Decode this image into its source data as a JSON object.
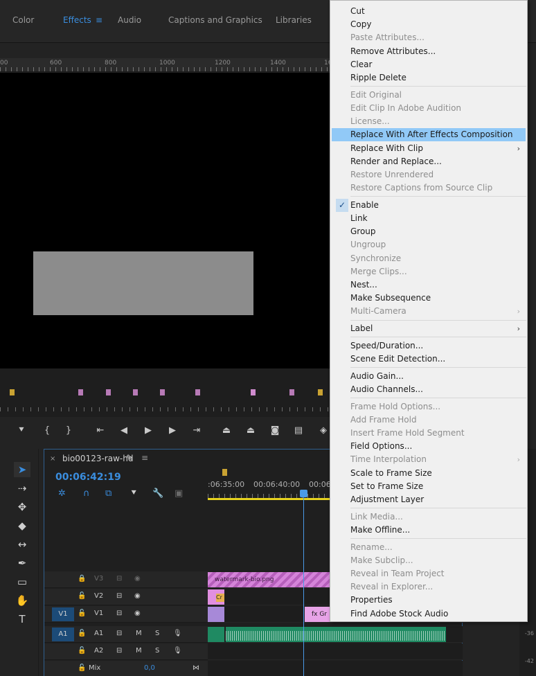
{
  "workspace_tabs": [
    {
      "label": "Color",
      "active": false
    },
    {
      "label": "Effects",
      "active": true
    },
    {
      "label": "Audio",
      "active": false
    },
    {
      "label": "Captions and Graphics",
      "active": false
    },
    {
      "label": "Libraries",
      "active": false
    }
  ],
  "program_ruler": [
    "00",
    "600",
    "800",
    "1000",
    "1200",
    "1400",
    "16"
  ],
  "sequence": {
    "close": "×",
    "name": "bio00123-raw-hd",
    "timecode": "00:06:42:19",
    "ruler_labels": [
      ":06:35:00",
      "00:06:40:00",
      "00:06"
    ]
  },
  "tracks": [
    {
      "target": "",
      "name": "V3",
      "dim": true
    },
    {
      "target": "",
      "name": "V2",
      "dim": false
    },
    {
      "target": "V1",
      "name": "V1",
      "dim": false
    },
    {
      "target": "A1",
      "name": "A1",
      "dim": false
    },
    {
      "target": "",
      "name": "A2",
      "dim": false
    }
  ],
  "track_buttons": {
    "mute": "M",
    "solo": "S"
  },
  "mix": {
    "label": "Mix",
    "value": "0,0"
  },
  "clips": {
    "watermark": "watermark-bio.png",
    "v2_label": "Cr",
    "v1_fx": "fx",
    "v1_label": "Gr"
  },
  "meter_labels": [
    "-36",
    "-42"
  ],
  "context_menu": [
    {
      "label": "Cut",
      "disabled": false
    },
    {
      "label": "Copy",
      "disabled": false
    },
    {
      "label": "Paste Attributes...",
      "disabled": true
    },
    {
      "label": "Remove Attributes...",
      "disabled": false
    },
    {
      "label": "Clear",
      "disabled": false
    },
    {
      "label": "Ripple Delete",
      "disabled": false,
      "sep_after": true
    },
    {
      "label": "Edit Original",
      "disabled": true
    },
    {
      "label": "Edit Clip In Adobe Audition",
      "disabled": true
    },
    {
      "label": "License...",
      "disabled": true
    },
    {
      "label": "Replace With After Effects Composition",
      "disabled": false,
      "highlight": true
    },
    {
      "label": "Replace With Clip",
      "disabled": false,
      "submenu": true
    },
    {
      "label": "Render and Replace...",
      "disabled": false
    },
    {
      "label": "Restore Unrendered",
      "disabled": true
    },
    {
      "label": "Restore Captions from Source Clip",
      "disabled": true,
      "sep_after": true
    },
    {
      "label": "Enable",
      "disabled": false,
      "checked": true
    },
    {
      "label": "Link",
      "disabled": false
    },
    {
      "label": "Group",
      "disabled": false
    },
    {
      "label": "Ungroup",
      "disabled": true
    },
    {
      "label": "Synchronize",
      "disabled": true
    },
    {
      "label": "Merge Clips...",
      "disabled": true
    },
    {
      "label": "Nest...",
      "disabled": false
    },
    {
      "label": "Make Subsequence",
      "disabled": false
    },
    {
      "label": "Multi-Camera",
      "disabled": true,
      "submenu": true,
      "sep_after": true
    },
    {
      "label": "Label",
      "disabled": false,
      "submenu": true,
      "sep_after": true
    },
    {
      "label": "Speed/Duration...",
      "disabled": false
    },
    {
      "label": "Scene Edit Detection...",
      "disabled": false,
      "sep_after": true
    },
    {
      "label": "Audio Gain...",
      "disabled": false
    },
    {
      "label": "Audio Channels...",
      "disabled": false,
      "sep_after": true
    },
    {
      "label": "Frame Hold Options...",
      "disabled": true
    },
    {
      "label": "Add Frame Hold",
      "disabled": true
    },
    {
      "label": "Insert Frame Hold Segment",
      "disabled": true
    },
    {
      "label": "Field Options...",
      "disabled": false
    },
    {
      "label": "Time Interpolation",
      "disabled": true,
      "submenu": true
    },
    {
      "label": "Scale to Frame Size",
      "disabled": false
    },
    {
      "label": "Set to Frame Size",
      "disabled": false
    },
    {
      "label": "Adjustment Layer",
      "disabled": false,
      "sep_after": true
    },
    {
      "label": "Link Media...",
      "disabled": true
    },
    {
      "label": "Make Offline...",
      "disabled": false,
      "sep_after": true
    },
    {
      "label": "Rename...",
      "disabled": true
    },
    {
      "label": "Make Subclip...",
      "disabled": true
    },
    {
      "label": "Reveal in Team Project",
      "disabled": true
    },
    {
      "label": "Reveal in Explorer...",
      "disabled": true
    },
    {
      "label": "Properties",
      "disabled": false
    },
    {
      "label": "Find Adobe Stock Audio",
      "disabled": false
    }
  ]
}
